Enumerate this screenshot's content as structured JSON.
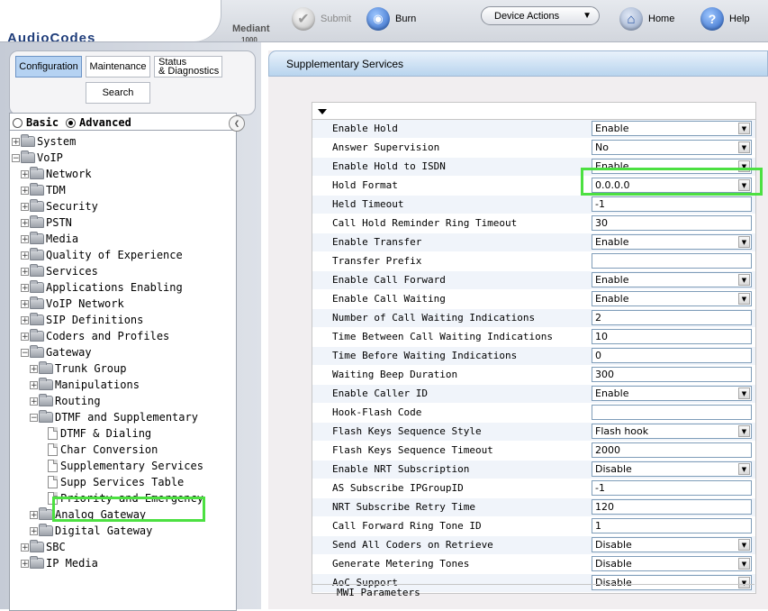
{
  "header": {
    "logo": "AudioCodes",
    "product": "Mediant",
    "product_model": "1000",
    "submit_label": "Submit",
    "burn_label": "Burn",
    "device_actions_label": "Device Actions",
    "home_label": "Home",
    "help_label": "Help"
  },
  "nav_tabs": {
    "configuration": "Configuration",
    "maintenance": "Maintenance",
    "status_line1": "Status",
    "status_line2": "& Diagnostics",
    "search": "Search"
  },
  "view_mode": {
    "basic": "Basic",
    "advanced": "Advanced",
    "selected": "Advanced"
  },
  "tree": [
    {
      "label": "System",
      "level": 0,
      "type": "folder",
      "expanded": false
    },
    {
      "label": "VoIP",
      "level": 0,
      "type": "folder",
      "expanded": true
    },
    {
      "label": "Network",
      "level": 1,
      "type": "folder",
      "expanded": false
    },
    {
      "label": "TDM",
      "level": 1,
      "type": "folder",
      "expanded": false
    },
    {
      "label": "Security",
      "level": 1,
      "type": "folder",
      "expanded": false
    },
    {
      "label": "PSTN",
      "level": 1,
      "type": "folder",
      "expanded": false
    },
    {
      "label": "Media",
      "level": 1,
      "type": "folder",
      "expanded": false
    },
    {
      "label": "Quality of Experience",
      "level": 1,
      "type": "folder",
      "expanded": false
    },
    {
      "label": "Services",
      "level": 1,
      "type": "folder",
      "expanded": false
    },
    {
      "label": "Applications Enabling",
      "level": 1,
      "type": "folder",
      "expanded": false
    },
    {
      "label": "VoIP Network",
      "level": 1,
      "type": "folder",
      "expanded": false
    },
    {
      "label": "SIP Definitions",
      "level": 1,
      "type": "folder",
      "expanded": false
    },
    {
      "label": "Coders and Profiles",
      "level": 1,
      "type": "folder",
      "expanded": false
    },
    {
      "label": "Gateway",
      "level": 1,
      "type": "folder",
      "expanded": true
    },
    {
      "label": "Trunk Group",
      "level": 2,
      "type": "folder",
      "expanded": false
    },
    {
      "label": "Manipulations",
      "level": 2,
      "type": "folder",
      "expanded": false
    },
    {
      "label": "Routing",
      "level": 2,
      "type": "folder",
      "expanded": false
    },
    {
      "label": "DTMF and Supplementary",
      "level": 2,
      "type": "folder",
      "expanded": true
    },
    {
      "label": "DTMF & Dialing",
      "level": 3,
      "type": "page"
    },
    {
      "label": "Char Conversion",
      "level": 3,
      "type": "page"
    },
    {
      "label": "Supplementary Services",
      "level": 3,
      "type": "page",
      "selected": true
    },
    {
      "label": "Supp Services Table",
      "level": 3,
      "type": "page"
    },
    {
      "label": "Priority and Emergency",
      "level": 3,
      "type": "page"
    },
    {
      "label": "Analog Gateway",
      "level": 2,
      "type": "folder",
      "expanded": false
    },
    {
      "label": "Digital Gateway",
      "level": 2,
      "type": "folder",
      "expanded": false
    },
    {
      "label": "SBC",
      "level": 1,
      "type": "folder",
      "expanded": false
    },
    {
      "label": "IP Media",
      "level": 1,
      "type": "folder",
      "expanded": false
    }
  ],
  "page": {
    "title": "Supplementary Services",
    "next_group_title": "MWI Parameters"
  },
  "settings": [
    {
      "label": "Enable Hold",
      "type": "select",
      "value": "Enable"
    },
    {
      "label": "Answer Supervision",
      "type": "select",
      "value": "No"
    },
    {
      "label": "Enable Hold to ISDN",
      "type": "select",
      "value": "Enable"
    },
    {
      "label": "Hold Format",
      "type": "select",
      "value": "0.0.0.0"
    },
    {
      "label": "Held Timeout",
      "type": "text",
      "value": "-1"
    },
    {
      "label": "Call Hold Reminder Ring Timeout",
      "type": "text",
      "value": "30"
    },
    {
      "label": "Enable Transfer",
      "type": "select",
      "value": "Enable"
    },
    {
      "label": "Transfer Prefix",
      "type": "text",
      "value": ""
    },
    {
      "label": "Enable Call Forward",
      "type": "select",
      "value": "Enable"
    },
    {
      "label": "Enable Call Waiting",
      "type": "select",
      "value": "Enable"
    },
    {
      "label": "Number of Call Waiting Indications",
      "type": "text",
      "value": "2"
    },
    {
      "label": "Time Between Call Waiting Indications",
      "type": "text",
      "value": "10"
    },
    {
      "label": "Time Before Waiting Indications",
      "type": "text",
      "value": "0"
    },
    {
      "label": "Waiting Beep Duration",
      "type": "text",
      "value": "300"
    },
    {
      "label": "Enable Caller ID",
      "type": "select",
      "value": "Enable"
    },
    {
      "label": "Hook-Flash Code",
      "type": "text",
      "value": ""
    },
    {
      "label": "Flash Keys Sequence Style",
      "type": "select",
      "value": "Flash hook"
    },
    {
      "label": "Flash Keys Sequence Timeout",
      "type": "text",
      "value": "2000"
    },
    {
      "label": "Enable NRT Subscription",
      "type": "select",
      "value": "Disable"
    },
    {
      "label": "AS Subscribe IPGroupID",
      "type": "text",
      "value": "-1"
    },
    {
      "label": "NRT Subscribe Retry Time",
      "type": "text",
      "value": "120"
    },
    {
      "label": "Call Forward Ring Tone ID",
      "type": "text",
      "value": "1"
    },
    {
      "label": "Send All Coders on Retrieve",
      "type": "select",
      "value": "Disable"
    },
    {
      "label": "Generate Metering Tones",
      "type": "select",
      "value": "Disable"
    },
    {
      "label": "AoC Support",
      "type": "select",
      "value": "Disable"
    }
  ],
  "colors": {
    "highlight": "#4ce041",
    "selected_tab": "#b5d2f2"
  }
}
